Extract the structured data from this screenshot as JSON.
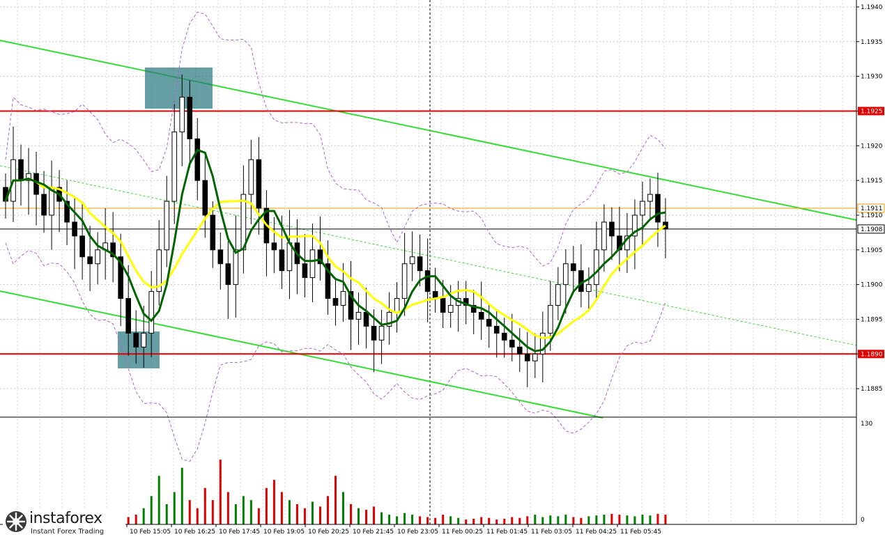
{
  "chart_data": {
    "type": "candlestick",
    "title": "",
    "y_axis": {
      "ticks": [
        "1.1940",
        "1.1935",
        "1.1930",
        "1.1925",
        "1.1920",
        "1.1915",
        "1.1910",
        "1.1905",
        "1.1900",
        "1.1895",
        "1.1890",
        "1.1885"
      ],
      "range": [
        1.1881,
        1.1941
      ]
    },
    "x_axis": {
      "ticks": [
        "10 Feb 15:05",
        "10 Feb 16:25",
        "10 Feb 17:45",
        "10 Feb 19:05",
        "10 Feb 20:25",
        "10 Feb 21:45",
        "10 Feb 23:05",
        "11 Feb 00:25",
        "11 Feb 01:45",
        "11 Feb 03:05",
        "11 Feb 04:25",
        "11 Feb 05:45"
      ]
    },
    "price_levels": [
      {
        "label": "1.1925",
        "value": 1.1925,
        "color": "#e00000"
      },
      {
        "label": "1.1890",
        "value": 1.189,
        "color": "#e00000"
      },
      {
        "label": "1.1911",
        "value": 1.1911,
        "color": "#e0a000"
      },
      {
        "label": "1.1908",
        "value": 1.1908,
        "color": "#000000"
      }
    ],
    "close_series": [
      1.1912,
      1.1918,
      1.1915,
      1.1916,
      1.1913,
      1.191,
      1.1914,
      1.1912,
      1.1909,
      1.1907,
      1.1904,
      1.1903,
      1.1905,
      1.1906,
      1.1904,
      1.1898,
      1.1893,
      1.1891,
      1.1893,
      1.1899,
      1.1905,
      1.1912,
      1.1922,
      1.1927,
      1.1921,
      1.1915,
      1.191,
      1.1905,
      1.1903,
      1.19,
      1.1905,
      1.1913,
      1.1918,
      1.1911,
      1.1906,
      1.1905,
      1.1902,
      1.1906,
      1.1903,
      1.1901,
      1.1905,
      1.1903,
      1.1898,
      1.1897,
      1.1899,
      1.1895,
      1.1896,
      1.1894,
      1.1892,
      1.1894,
      1.1896,
      1.1898,
      1.1903,
      1.1904,
      1.1902,
      1.1899,
      1.1898,
      1.1896,
      1.1897,
      1.1898,
      1.1897,
      1.1896,
      1.1895,
      1.1894,
      1.1893,
      1.1892,
      1.1891,
      1.189,
      1.1889,
      1.189,
      1.1893,
      1.1897,
      1.19,
      1.1903,
      1.1902,
      1.1899,
      1.19,
      1.1905,
      1.1909,
      1.1907,
      1.1905,
      1.1907,
      1.191,
      1.1912,
      1.1913,
      1.1909,
      1.1908
    ],
    "ma_fast_label": "",
    "ma_slow_label": "",
    "volume": {
      "max_label": "130",
      "min_label": "0",
      "max": 130,
      "values": [
        5,
        4,
        6,
        5,
        7,
        3,
        6,
        4,
        5,
        6,
        8,
        5,
        4,
        6,
        7,
        5,
        9,
        12,
        20,
        35,
        60,
        25,
        40,
        70,
        30,
        20,
        45,
        30,
        80,
        40,
        25,
        35,
        30,
        20,
        45,
        55,
        40,
        30,
        25,
        20,
        28,
        22,
        35,
        60,
        40,
        25,
        20,
        18,
        22,
        15,
        12,
        10,
        14,
        12,
        10,
        9,
        8,
        12,
        10,
        8,
        6,
        7,
        9,
        8,
        6,
        7,
        9,
        8,
        10,
        12,
        9,
        11,
        10,
        12,
        9,
        8,
        10,
        11,
        12,
        13,
        12,
        11,
        10,
        12,
        11,
        13,
        12
      ]
    },
    "colors": {
      "up": "#008000",
      "down": "#e00000",
      "ma_fast": "#006400",
      "ma_slow": "#ffff00",
      "channel": "#33dd33",
      "envelope": "#b060d0",
      "box": "#2a7a80"
    }
  },
  "logo": {
    "brand": "instaforex",
    "tagline": "Instant Forex Trading"
  }
}
